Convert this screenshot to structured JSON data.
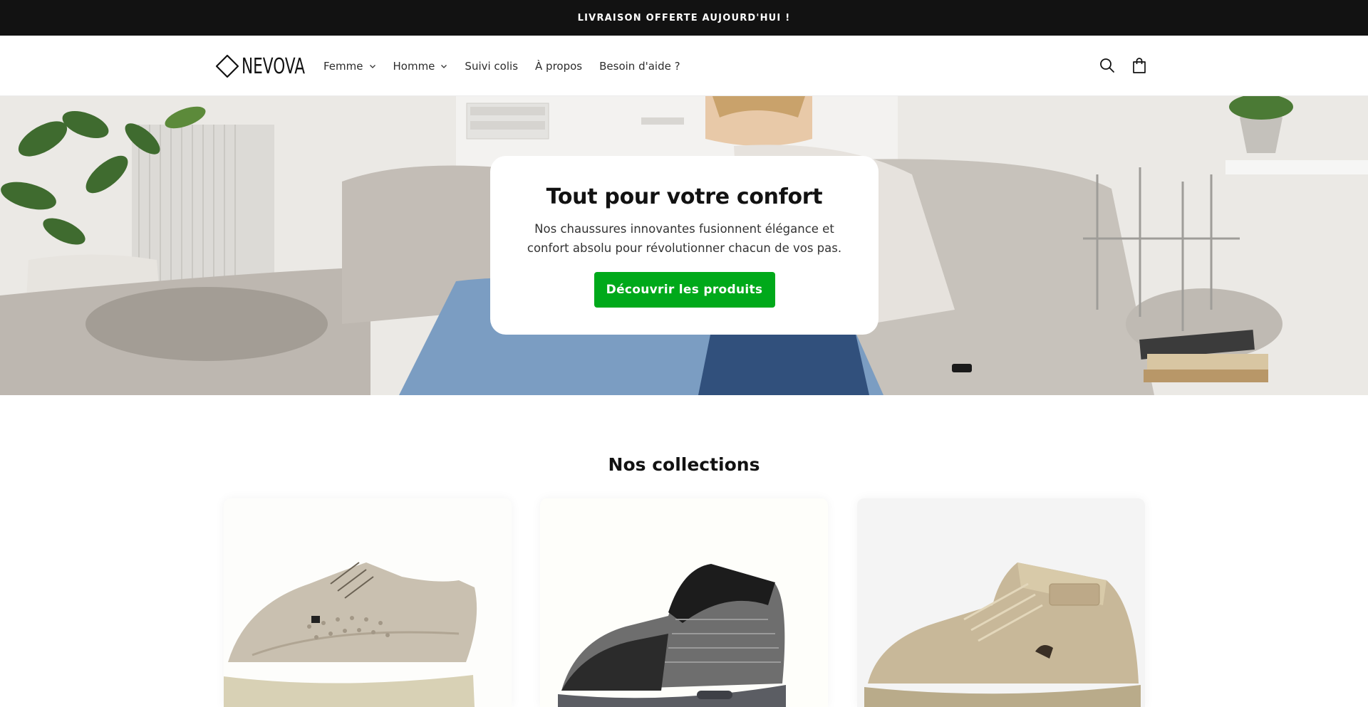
{
  "announcement": {
    "text": "LIVRAISON OFFERTE AUJOURD'HUI !"
  },
  "brand": {
    "name": "NEVOVA"
  },
  "nav": {
    "items": [
      {
        "label": "Femme",
        "has_dropdown": true
      },
      {
        "label": "Homme",
        "has_dropdown": true
      },
      {
        "label": "Suivi colis",
        "has_dropdown": false
      },
      {
        "label": "À propos",
        "has_dropdown": false
      },
      {
        "label": "Besoin d'aide ?",
        "has_dropdown": false
      }
    ],
    "icons": [
      "search-icon",
      "cart-icon"
    ]
  },
  "hero": {
    "title": "Tout pour votre confort",
    "text": "Nos chaussures innovantes fusionnent élégance et confort absolu pour révolutionner chacun de vos pas.",
    "button_label": "Découvrir les produits",
    "button_color": "#00a91a"
  },
  "collections": {
    "title": "Nos collections",
    "cards": [
      {
        "image": "beige mesh lace-up shoe"
      },
      {
        "image": "black and grey knit sock sneaker"
      },
      {
        "image": "beige suede high-top shoe"
      }
    ]
  },
  "colors": {
    "announcement_bg": "#121212",
    "accent": "#00a91a"
  }
}
